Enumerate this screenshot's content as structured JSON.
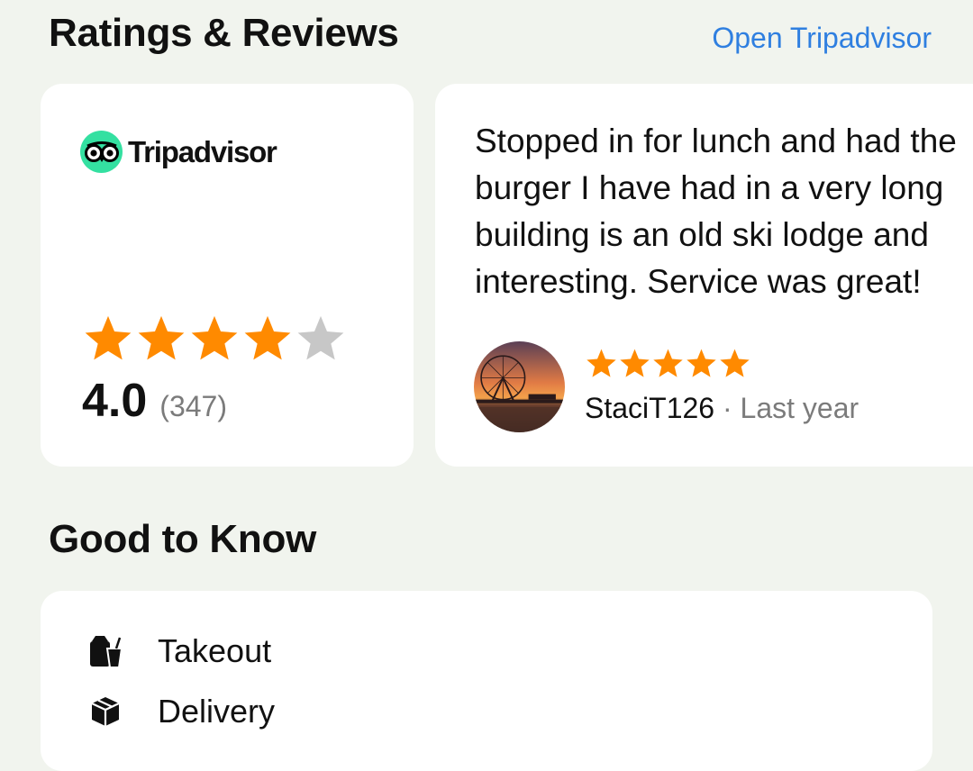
{
  "ratings": {
    "title": "Ratings & Reviews",
    "open_link": "Open Tripadvisor",
    "provider": "Tripadvisor",
    "score_text": "4.0",
    "review_count": "(347)",
    "stars": 4,
    "stars_max": 5,
    "star_color": "#ff8a00",
    "star_empty_color": "#c7c7c7"
  },
  "review": {
    "lines": [
      "Stopped in for lunch and had the",
      "burger I have had in a very long",
      "building is an old ski lodge and",
      "interesting. Service was great!"
    ],
    "stars": 5,
    "author": "StaciT126",
    "separator": "·",
    "when": "Last year"
  },
  "good_to_know": {
    "title": "Good to Know",
    "items": [
      {
        "label": "Takeout",
        "icon": "takeout-bag-icon"
      },
      {
        "label": "Delivery",
        "icon": "delivery-box-icon"
      }
    ]
  },
  "colors": {
    "link": "#2f7fe0",
    "tripadvisor_green": "#34e0a1",
    "background": "#f1f4ee"
  }
}
